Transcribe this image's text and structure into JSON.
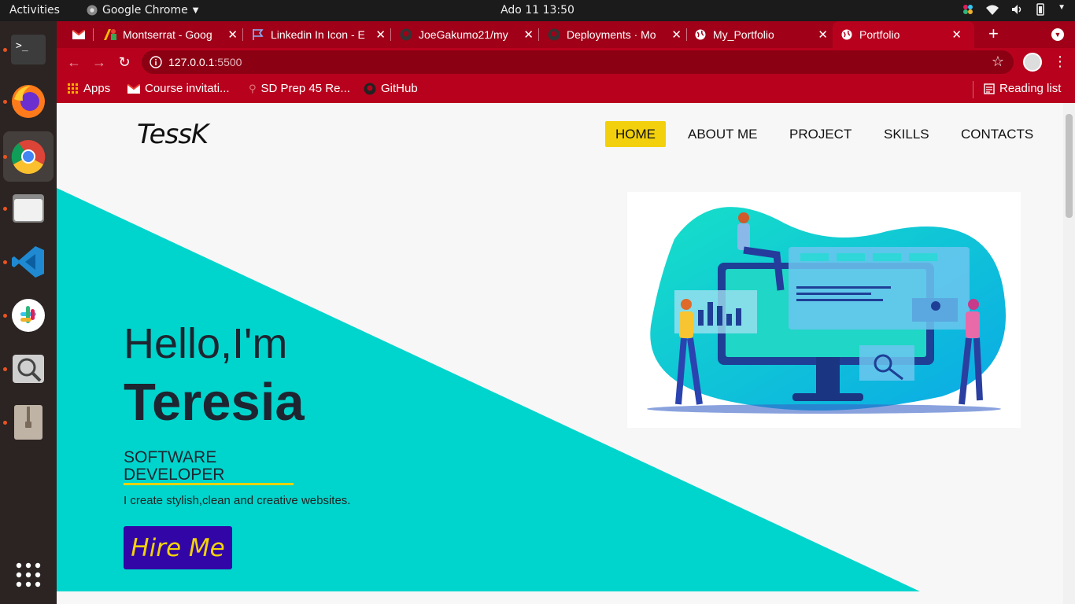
{
  "system": {
    "activities": "Activities",
    "app_name": "Google Chrome",
    "clock": "Ado 11  13:50"
  },
  "tabs": [
    {
      "label": "Montserrat - Goog",
      "icon": "google-fonts-icon"
    },
    {
      "label": "Linkedin In Icon - E",
      "icon": "flag-icon"
    },
    {
      "label": "JoeGakumo21/my",
      "icon": "github-icon"
    },
    {
      "label": "Deployments · Mo",
      "icon": "github-icon"
    },
    {
      "label": "My_Portfolio",
      "icon": "globe-icon"
    },
    {
      "label": "Portfolio",
      "icon": "globe-icon",
      "active": true
    }
  ],
  "address": {
    "host": "127.0.0.1",
    "port": ":5500"
  },
  "bookmarks": {
    "apps": "Apps",
    "items": [
      "Course invitati...",
      "SD Prep 45 Re...",
      "GitHub"
    ],
    "reading_list": "Reading list"
  },
  "site": {
    "logo": "TessK",
    "nav": [
      "HOME",
      "ABOUT ME",
      "PROJECT",
      "SKILLS",
      "CONTACTS"
    ],
    "hello": "Hello,I'm",
    "name": "Teresia",
    "role": "SOFTWARE DEVELOPER",
    "tagline": "I create stylish,clean and creative websites.",
    "hire_button": "Hire Me"
  },
  "colors": {
    "chrome_theme": "#b8021d",
    "triangle": "#00d5cd",
    "home_highlight": "#f2d00d",
    "hire_bg": "#3206a6",
    "hire_text": "#f3d20a"
  }
}
